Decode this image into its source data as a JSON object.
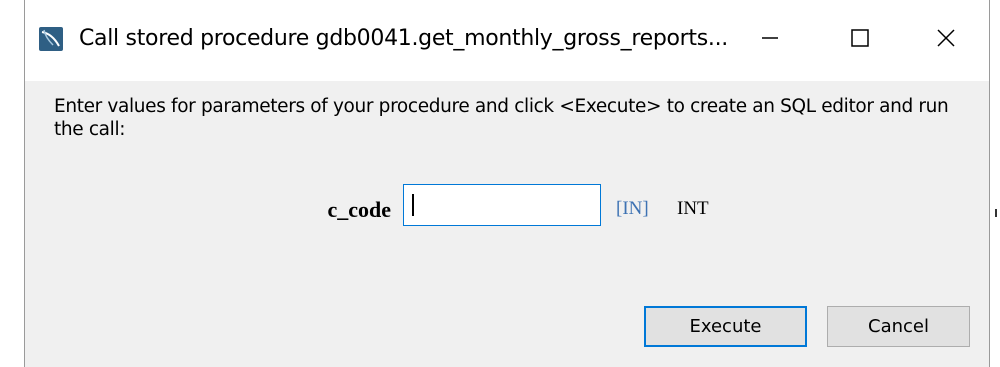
{
  "window": {
    "title": "Call stored procedure gdb0041.get_monthly_gross_reports...",
    "app_icon": "mysql-workbench-icon",
    "controls": [
      "minimize-icon",
      "maximize-icon",
      "close-icon"
    ]
  },
  "prompt": "Enter values for parameters of your procedure and click <Execute> to create an SQL editor and run the call:",
  "parameter": {
    "name": "c_code",
    "value": "",
    "direction": "[IN]",
    "type": "INT"
  },
  "buttons": {
    "execute": "Execute",
    "cancel": "Cancel"
  },
  "colors": {
    "accent": "#0078d7",
    "direction_text": "#3d72b3",
    "dialog_bg": "#f0f0f0"
  }
}
